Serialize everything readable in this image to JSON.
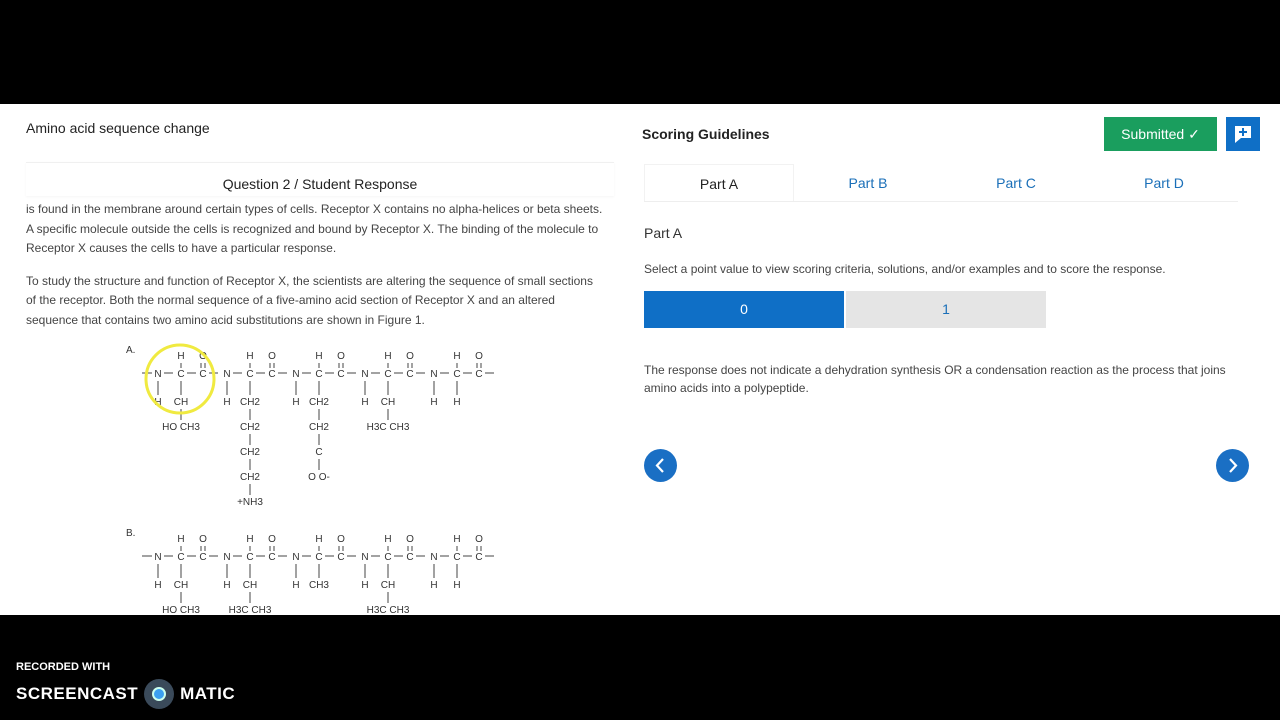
{
  "left": {
    "title": "Amino acid sequence change",
    "question_header": "Question 2 / Student Response",
    "paragraphs": [
      "is found in the membrane around certain types of cells. Receptor X contains no alpha-helices or beta sheets. A specific molecule outside the cells is recognized and bound by Receptor X. The binding of the molecule to Receptor X causes the cells to have a particular response.",
      "To study the structure and function of Receptor X, the scientists are altering the sequence of small sections of the receptor. Both the normal sequence of a five-amino acid section of Receptor X and an altered sequence that contains two amino acid substitutions are shown in Figure 1."
    ],
    "figure": {
      "A": {
        "label": "A.",
        "side_chains": [
          [
            "CH",
            "HO  CH3"
          ],
          [
            "CH2",
            "CH2",
            "CH2",
            "CH2",
            "+NH3"
          ],
          [
            "CH2",
            "CH2",
            "C",
            "O   O-"
          ],
          [
            "CH",
            "H3C  CH3"
          ],
          [
            "H"
          ]
        ]
      },
      "B": {
        "label": "B.",
        "side_chains": [
          [
            "CH",
            "HO  CH3"
          ],
          [
            "CH",
            "H3C  CH3"
          ],
          [
            "CH3"
          ],
          [
            "CH",
            "H3C  CH3"
          ],
          [
            "H"
          ]
        ]
      }
    }
  },
  "right": {
    "title": "Scoring Guidelines",
    "submitted_label": "Submitted ✓",
    "comment_icon": "comment-plus-icon",
    "tabs": [
      "Part A",
      "Part B",
      "Part C",
      "Part D"
    ],
    "active_tab": "Part A",
    "part_heading": "Part A",
    "instructions": "Select a point value to view scoring criteria, solutions, and/or examples and to score the response.",
    "scores": [
      "0",
      "1"
    ],
    "selected_score": "0",
    "criteria": "The response does not indicate a dehydration synthesis OR a condensation reaction as the process that joins amino acids into a polypeptide.",
    "colors": {
      "accent": "#0f6fc6",
      "submitted": "#1a9e5e"
    }
  },
  "watermark": {
    "line1": "RECORDED WITH",
    "brand_left": "SCREENCAST",
    "brand_right": "MATIC"
  }
}
